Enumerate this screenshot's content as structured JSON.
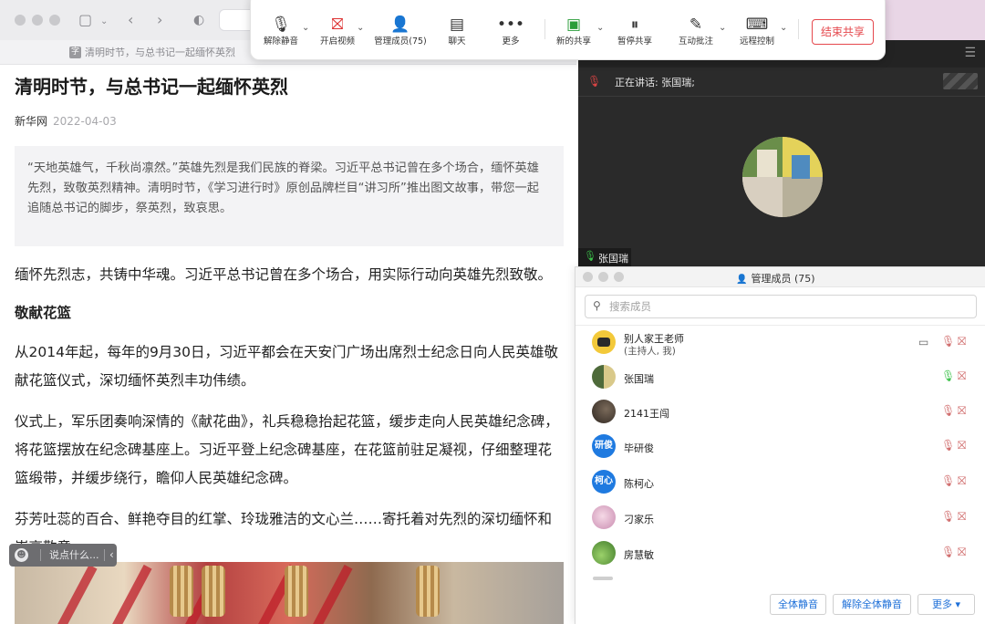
{
  "browser": {
    "tab_title": "清明时节，与总书记一起缅怀英烈",
    "tab_icon": "字"
  },
  "article": {
    "title": "清明时节，与总书记一起缅怀英烈",
    "source": "新华网",
    "date": "2022-04-03",
    "quote": "“天地英雄气，千秋尚凛然。”英雄先烈是我们民族的脊梁。习近平总书记曾在多个场合，缅怀英雄先烈，致敬英烈精神。清明时节，《学习进行时》原创品牌栏目“讲习所”推出图文故事，带您一起追随总书记的脚步，祭英烈，致哀思。",
    "paragraph1": "缅怀先烈志，共铸中华魂。习近平总书记曾在多个场合，用实际行动向英雄先烈致敬。",
    "heading1": "敬献花篮",
    "paragraph2": "从2014年起，每年的9月30日，习近平都会在天安门广场出席烈士纪念日向人民英雄敬献花篮仪式，深切缅怀英烈丰功伟绩。",
    "paragraph3": "仪式上，军乐团奏响深情的《献花曲》，礼兵稳稳抬起花篮，缓步走向人民英雄纪念碑，将花篮摆放在纪念碑基座上。习近平登上纪念碑基座，在花篮前驻足凝视，仔细整理花篮缎带，并缓步绕行，瞻仰人民英雄纪念碑。",
    "paragraph4": "芬芳吐蕊的百合、鲜艳夺目的红掌、玲珑雅洁的文心兰……寄托着对先烈的深切缅怀和崇高敬意。"
  },
  "comment_bar": {
    "placeholder": "说点什么..."
  },
  "meeting_toolbar": {
    "items": [
      {
        "label": "解除静音",
        "icon": "mic-muted-icon"
      },
      {
        "label": "开启视频",
        "icon": "video-off-icon"
      },
      {
        "label": "管理成员(75)",
        "icon": "members-icon"
      },
      {
        "label": "聊天",
        "icon": "chat-icon"
      },
      {
        "label": "更多",
        "icon": "more-icon"
      },
      {
        "label": "新的共享",
        "icon": "new-share-icon"
      },
      {
        "label": "暂停共享",
        "icon": "pause-share-icon"
      },
      {
        "label": "互动批注",
        "icon": "annotate-icon"
      },
      {
        "label": "远程控制",
        "icon": "remote-control-icon"
      }
    ],
    "end_label": "结束共享",
    "end_color": "#e5484d"
  },
  "video": {
    "speaking_label": "正在讲话: 张国瑞;",
    "tile_name": "张国瑞"
  },
  "member_panel": {
    "title": "管理成员 (75)",
    "search_placeholder": "搜索成员",
    "members": [
      {
        "name": "别人家王老师",
        "sub": "(主持人, 我)",
        "mic": "muted",
        "sharing": true
      },
      {
        "name": "张国瑞",
        "mic": "active"
      },
      {
        "name": "2141王闯",
        "mic": "muted"
      },
      {
        "name": "毕研俊",
        "avatar_text": "研俊",
        "mic": "muted"
      },
      {
        "name": "陈柯心",
        "avatar_text": "柯心",
        "mic": "muted"
      },
      {
        "name": "刁家乐",
        "mic": "muted"
      },
      {
        "name": "房慧敏",
        "mic": "muted"
      }
    ],
    "buttons": {
      "mute_all": "全体静音",
      "unmute_all": "解除全体静音",
      "more": "更多 ▾"
    }
  },
  "colors": {
    "accent_blue": "#1d6fd8",
    "mic_active": "#3cc24a",
    "mic_muted": "#d06b6b"
  }
}
